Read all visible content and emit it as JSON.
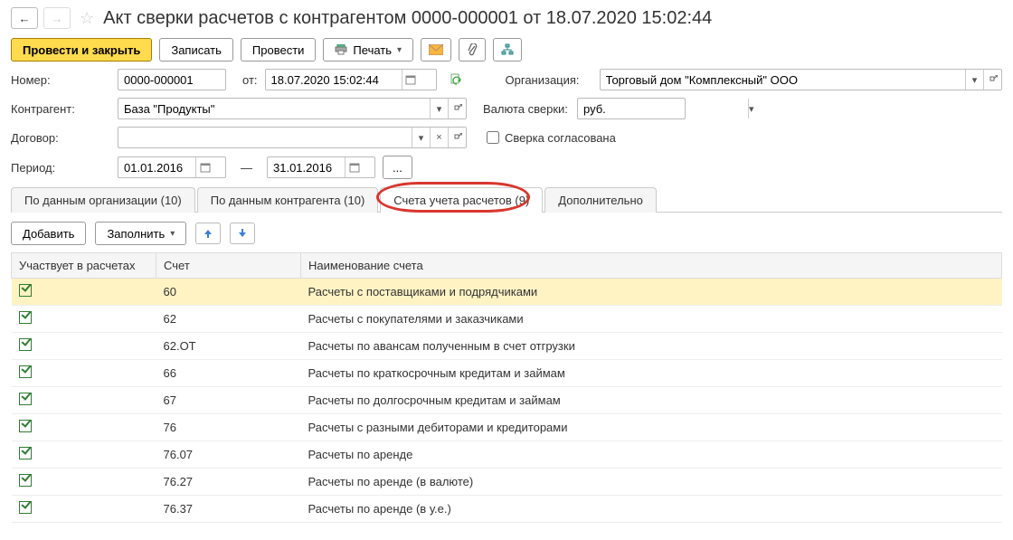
{
  "header": {
    "title": "Акт сверки расчетов с контрагентом 0000-000001 от 18.07.2020 15:02:44"
  },
  "toolbar": {
    "post_close": "Провести и закрыть",
    "save": "Записать",
    "post": "Провести",
    "print": "Печать"
  },
  "form": {
    "number_label": "Номер:",
    "number_value": "0000-000001",
    "from_label": "от:",
    "date_value": "18.07.2020 15:02:44",
    "org_label": "Организация:",
    "org_value": "Торговый дом \"Комплексный\" ООО",
    "counterparty_label": "Контрагент:",
    "counterparty_value": "База \"Продукты\"",
    "currency_label": "Валюта сверки:",
    "currency_value": "руб.",
    "contract_label": "Договор:",
    "contract_value": "",
    "agreed_label": "Сверка согласована",
    "period_label": "Период:",
    "period_start": "01.01.2016",
    "period_end": "31.01.2016"
  },
  "tabs": {
    "t1": "По данным организации (10)",
    "t2": "По данным контрагента (10)",
    "t3": "Счета учета расчетов (9)",
    "t4": "Дополнительно"
  },
  "subtoolbar": {
    "add": "Добавить",
    "fill": "Заполнить"
  },
  "grid": {
    "col1": "Участвует в расчетах",
    "col2": "Счет",
    "col3": "Наименование счета",
    "rows": [
      {
        "acct": "60",
        "name": "Расчеты с поставщиками и подрядчиками"
      },
      {
        "acct": "62",
        "name": "Расчеты с покупателями и заказчиками"
      },
      {
        "acct": "62.ОТ",
        "name": "Расчеты по авансам полученным в счет отгрузки"
      },
      {
        "acct": "66",
        "name": "Расчеты по краткосрочным кредитам и займам"
      },
      {
        "acct": "67",
        "name": "Расчеты по долгосрочным кредитам и займам"
      },
      {
        "acct": "76",
        "name": "Расчеты с разными дебиторами и кредиторами"
      },
      {
        "acct": "76.07",
        "name": "Расчеты по аренде"
      },
      {
        "acct": "76.27",
        "name": "Расчеты по аренде (в валюте)"
      },
      {
        "acct": "76.37",
        "name": "Расчеты по аренде (в у.е.)"
      }
    ]
  }
}
